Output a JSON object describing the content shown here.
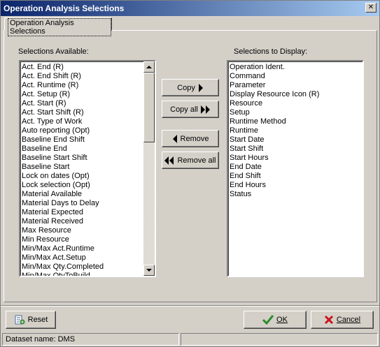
{
  "window": {
    "title": "Operation Analysis Selections",
    "close_glyph": "✕"
  },
  "tab": {
    "label": "Operation Analysis Selections"
  },
  "available": {
    "label": "Selections Available:",
    "items": [
      "Act. End (R)",
      "Act. End Shift (R)",
      "Act. Runtime (R)",
      "Act. Setup (R)",
      "Act. Start (R)",
      "Act. Start Shift (R)",
      "Act. Type of Work",
      "Auto reporting (Opt)",
      "Baseline End Shift",
      "Baseline End",
      "Baseline Start Shift",
      "Baseline Start",
      "Lock on dates (Opt)",
      "Lock selection (Opt)",
      "Material Available",
      "Material Days to Delay",
      "Material Expected",
      "Material Received",
      "Max Resource",
      "Min Resource",
      "Min/Max Act.Runtime",
      "Min/Max Act.Setup",
      "Min/Max Qty.Completed",
      "Min/Max QtyToBuild"
    ]
  },
  "display": {
    "label": "Selections to Display:",
    "items": [
      "Operation Ident.",
      "Command",
      "Parameter",
      "Display Resource Icon (R)",
      "Resource",
      "Setup",
      "Runtime Method",
      "Runtime",
      "Start Date",
      "Start Shift",
      "Start Hours",
      "End Date",
      "End Shift",
      "End Hours",
      "Status"
    ]
  },
  "buttons": {
    "copy": "Copy",
    "copy_all": "Copy all",
    "remove": "Remove",
    "remove_all": "Remove all",
    "reset": "Reset",
    "ok": "OK",
    "cancel": "Cancel"
  },
  "status": {
    "dataset": "Dataset name:  DMS",
    "extra": ""
  },
  "icons": {
    "copy": "arrow-right-icon",
    "copy_all": "double-arrow-right-icon",
    "remove": "arrow-left-icon",
    "remove_all": "double-arrow-left-icon",
    "reset": "reset-icon",
    "ok": "checkmark-icon",
    "cancel": "x-icon"
  },
  "colors": {
    "title_start": "#0a246a",
    "title_end": "#a6caf0",
    "ok_green": "#2e8b2e",
    "cancel_red": "#c8141e"
  }
}
